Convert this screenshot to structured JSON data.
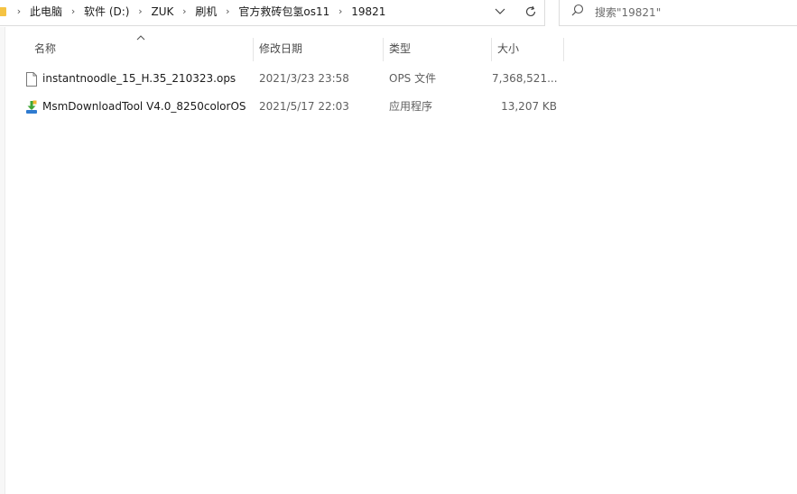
{
  "breadcrumb": {
    "items": [
      "此电脑",
      "软件 (D:)",
      "ZUK",
      "刷机",
      "官方救砖包氢os11",
      "19821"
    ]
  },
  "search": {
    "placeholder": "搜索\"19821\""
  },
  "columns": {
    "name": "名称",
    "date": "修改日期",
    "type": "类型",
    "size": "大小"
  },
  "files": [
    {
      "name": "instantnoodle_15_H.35_210323.ops",
      "date": "2021/3/23 23:58",
      "type": "OPS 文件",
      "size": "7,368,521...",
      "icon": "document-icon"
    },
    {
      "name": "MsmDownloadTool V4.0_8250colorOS",
      "date": "2021/5/17 22:03",
      "type": "应用程序",
      "size": "13,207 KB",
      "icon": "download-tool-icon"
    }
  ],
  "colors": {
    "folder": "#f5c343",
    "border": "#dcdcdc",
    "app_icon_green": "#3fa535"
  }
}
